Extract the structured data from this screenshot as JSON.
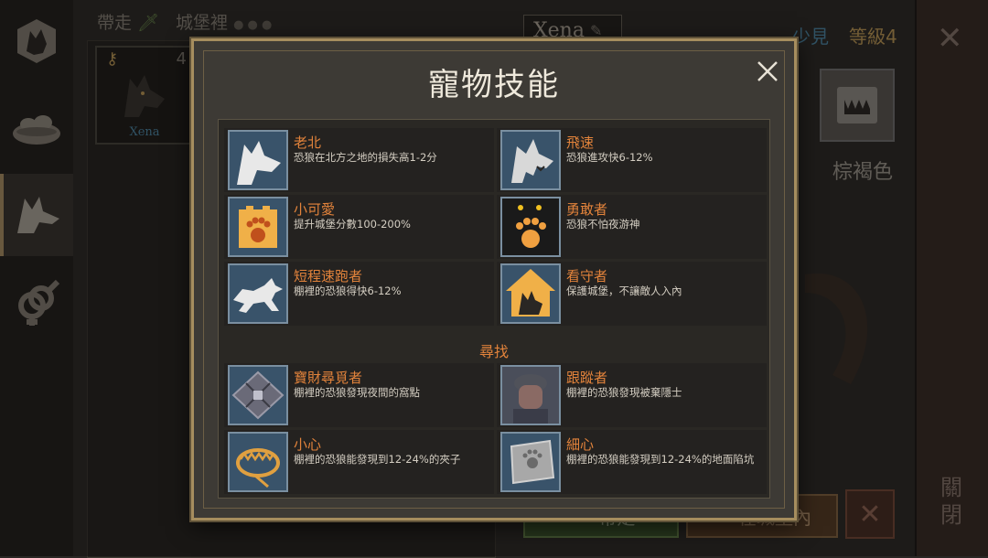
{
  "background": {
    "tab_carry": "帶走",
    "tab_castle": "城堡裡",
    "pet_slot_count": "4",
    "pet_slot_name": "Xena",
    "pet_name": "Xena",
    "rarity": "少見",
    "level": "等級4",
    "color_label": "棕褐色",
    "btn_carry": "帶走",
    "btn_in_castle": "在城堡內",
    "close_side": "關閉"
  },
  "modal": {
    "title": "寵物技能",
    "section_find": "尋找",
    "skills": [
      {
        "name": "老北",
        "desc": "恐狼在北方之地的損失高1-2分",
        "icon": "white-wolf-icon"
      },
      {
        "name": "飛速",
        "desc": "恐狼進攻快6-12%",
        "icon": "snarling-wolf-icon"
      },
      {
        "name": "小可愛",
        "desc": "提升城堡分數100-200%",
        "icon": "paw-castle-icon"
      },
      {
        "name": "勇敢者",
        "desc": "恐狼不怕夜游神",
        "icon": "night-paw-icon"
      },
      {
        "name": "短程速跑者",
        "desc": "棚裡的恐狼得快6-12%",
        "icon": "running-wolf-icon"
      },
      {
        "name": "看守者",
        "desc": "保護城堡，不讓敵人入內",
        "icon": "guard-house-icon"
      }
    ],
    "find_skills": [
      {
        "name": "寶財尋覓者",
        "desc": "棚裡的恐狼發現夜間的窩點",
        "icon": "treasure-grid-icon"
      },
      {
        "name": "跟蹤者",
        "desc": "棚裡的恐狼發現被棄隱士",
        "icon": "soldier-portrait-icon"
      },
      {
        "name": "小心",
        "desc": "棚裡的恐狼能發現到12-24%的夾子",
        "icon": "bear-trap-icon"
      },
      {
        "name": "細心",
        "desc": "棚裡的恐狼能發現到12-24%的地面陷坑",
        "icon": "ground-pit-icon"
      }
    ]
  },
  "colors": {
    "accent": "#e2833b",
    "frame": "#a68d5e"
  }
}
